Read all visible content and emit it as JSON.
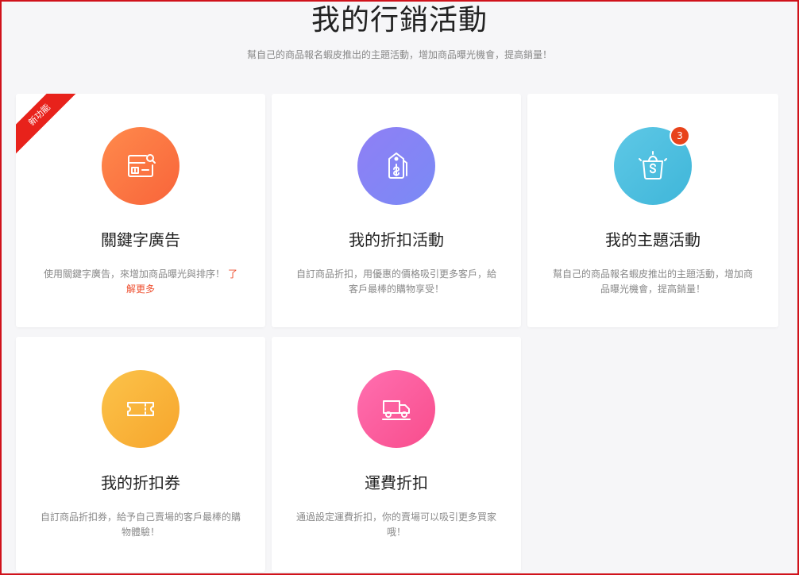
{
  "header": {
    "title": "我的行銷活動",
    "subtitle": "幫自己的商品報名蝦皮推出的主題活動，增加商品曝光機會，提高銷量！"
  },
  "cards": [
    {
      "title": "關鍵字廣告",
      "description": "使用關鍵字廣告，來增加商品曝光與排序！",
      "link_label": "了解更多",
      "ribbon_label": "新功能",
      "icon": "ad-card-icon",
      "color_start": "#ff8a4c",
      "color_end": "#f8643a"
    },
    {
      "title": "我的折扣活動",
      "description": "自訂商品折扣，用優惠的價格吸引更多客戶，給客戶最棒的購物享受！",
      "icon": "price-tag-icon",
      "color_start": "#8f7ff5",
      "color_end": "#7a8af5"
    },
    {
      "title": "我的主題活動",
      "description": "幫自己的商品報名蝦皮推出的主題活動，增加商品曝光機會，提高銷量！",
      "badge_count": "3",
      "icon": "shopping-bag-icon",
      "color_start": "#5ec8e6",
      "color_end": "#3fb6d9"
    },
    {
      "title": "我的折扣券",
      "description": "自訂商品折扣券，給予自己賣場的客戶最棒的購物體驗！",
      "icon": "coupon-icon",
      "color_start": "#fbc34a",
      "color_end": "#f7a52c"
    },
    {
      "title": "運費折扣",
      "description": "通過設定運費折扣，你的賣場可以吸引更多買家哦！",
      "icon": "delivery-truck-icon",
      "color_start": "#ff6fb0",
      "color_end": "#f84d8c"
    }
  ]
}
